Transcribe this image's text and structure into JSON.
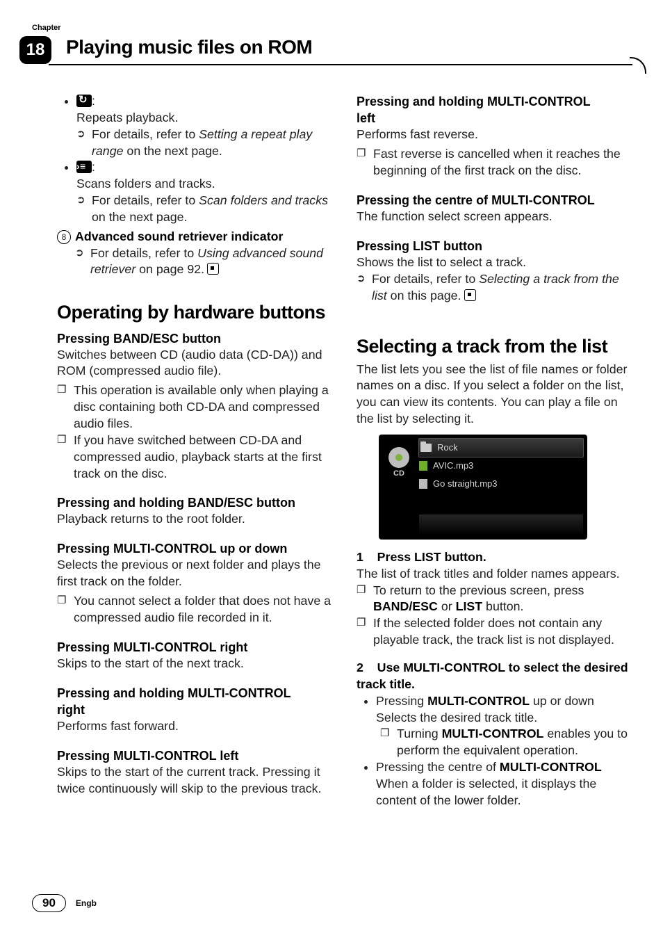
{
  "chapter": {
    "label": "Chapter",
    "number": "18",
    "title": "Playing music files on ROM"
  },
  "footer": {
    "page": "90",
    "lang": "Engb"
  },
  "left": {
    "repeat": {
      "desc": "Repeats playback.",
      "detail_prefix": "For details, refer to ",
      "detail_link": "Setting a repeat play range",
      "detail_suffix": " on the next page."
    },
    "scan": {
      "desc": "Scans folders and tracks.",
      "detail_prefix": "For details, refer to ",
      "detail_link": "Scan folders and tracks",
      "detail_suffix": " on the next page."
    },
    "adv": {
      "num": "8",
      "title": "Advanced sound retriever indicator",
      "detail_prefix": "For details, refer to ",
      "detail_link": "Using advanced sound retriever",
      "detail_suffix": " on page 92."
    },
    "hw": {
      "heading": "Operating by hardware buttons",
      "band": {
        "h": "Pressing BAND/ESC button",
        "p": "Switches between CD (audio data (CD-DA)) and ROM (compressed audio file).",
        "b1": "This operation is available only when playing a disc containing both CD-DA and compressed audio files.",
        "b2": "If you have switched between CD-DA and compressed audio, playback starts at the first track on the disc."
      },
      "bandhold": {
        "h": "Pressing and holding BAND/ESC button",
        "p": "Playback returns to the root folder."
      },
      "mcud": {
        "h": "Pressing MULTI-CONTROL up or down",
        "p": "Selects the previous or next folder and plays the first track on the folder.",
        "b1": "You cannot select a folder that does not have a compressed audio file recorded in it."
      },
      "mcr": {
        "h": "Pressing MULTI-CONTROL right",
        "p": "Skips to the start of the next track."
      },
      "mcrh": {
        "h": "Pressing and holding MULTI-CONTROL right",
        "p": "Performs fast forward."
      },
      "mcl": {
        "h": "Pressing MULTI-CONTROL left",
        "p": "Skips to the start of the current track. Pressing it twice continuously will skip to the previous track."
      }
    }
  },
  "right": {
    "mclh": {
      "h": "Pressing and holding MULTI-CONTROL left",
      "p": "Performs fast reverse.",
      "b1": "Fast reverse is cancelled when it reaches the beginning of the first track on the disc."
    },
    "mcc": {
      "h": "Pressing the centre of MULTI-CONTROL",
      "p": "The function select screen appears."
    },
    "list": {
      "h": "Pressing LIST button",
      "p": "Shows the list to select a track.",
      "detail_prefix": "For details, refer to ",
      "detail_link": "Selecting a track from the list",
      "detail_suffix": " on this page."
    },
    "sel": {
      "heading": "Selecting a track from the list",
      "intro": "The list lets you see the list of file names or folder names on a disc. If you select a folder on the list, you can view its contents. You can play a file on the list by selecting it.",
      "shot": {
        "cd": "CD",
        "row1": "Rock",
        "row2": "AVIC.mp3",
        "row3": "Go straight.mp3"
      },
      "step1": {
        "num": "1",
        "h": "Press LIST button.",
        "p": "The list of track titles and folder names appears.",
        "b1a": "To return to the previous screen, press ",
        "b1b": "BAND/ESC",
        "b1c": " or ",
        "b1d": "LIST",
        "b1e": " button.",
        "b2": "If the selected folder does not contain any playable track, the track list is not displayed."
      },
      "step2": {
        "num": "2",
        "h": "Use MULTI-CONTROL to select the desired track title.",
        "d1a": "Pressing ",
        "d1b": "MULTI-CONTROL",
        "d1c": " up or down",
        "d1p": "Selects the desired track title.",
        "d1_sub_a": "Turning ",
        "d1_sub_b": "MULTI-CONTROL",
        "d1_sub_c": " enables you to perform the equivalent operation.",
        "d2a": "Pressing the centre of ",
        "d2b": "MULTI-CONTROL",
        "d2p": "When a folder is selected, it displays the content of the lower folder."
      }
    }
  }
}
